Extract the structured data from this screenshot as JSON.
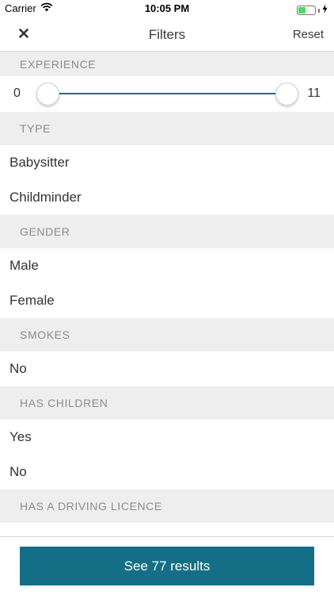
{
  "status_bar": {
    "carrier": "Carrier",
    "time": "10:05 PM",
    "battery_level": 0.45
  },
  "nav": {
    "title": "Filters",
    "reset_label": "Reset",
    "close_icon": "close-icon"
  },
  "experience": {
    "header": "EXPERIENCE",
    "min_label": "0",
    "max_label": "11",
    "range": [
      0,
      11
    ],
    "selected": [
      0,
      11
    ],
    "track_color": "#1e6f86"
  },
  "type": {
    "header": "TYPE",
    "options": [
      "Babysitter",
      "Childminder"
    ]
  },
  "gender": {
    "header": "GENDER",
    "options": [
      "Male",
      "Female"
    ]
  },
  "smokes": {
    "header": "SMOKES",
    "options": [
      "No"
    ]
  },
  "has_children": {
    "header": "HAS CHILDREN",
    "options": [
      "Yes",
      "No"
    ]
  },
  "driving_licence": {
    "header": "HAS A DRIVING LICENCE"
  },
  "footer": {
    "results_label": "See 77 results",
    "button_color": "#146f86"
  }
}
